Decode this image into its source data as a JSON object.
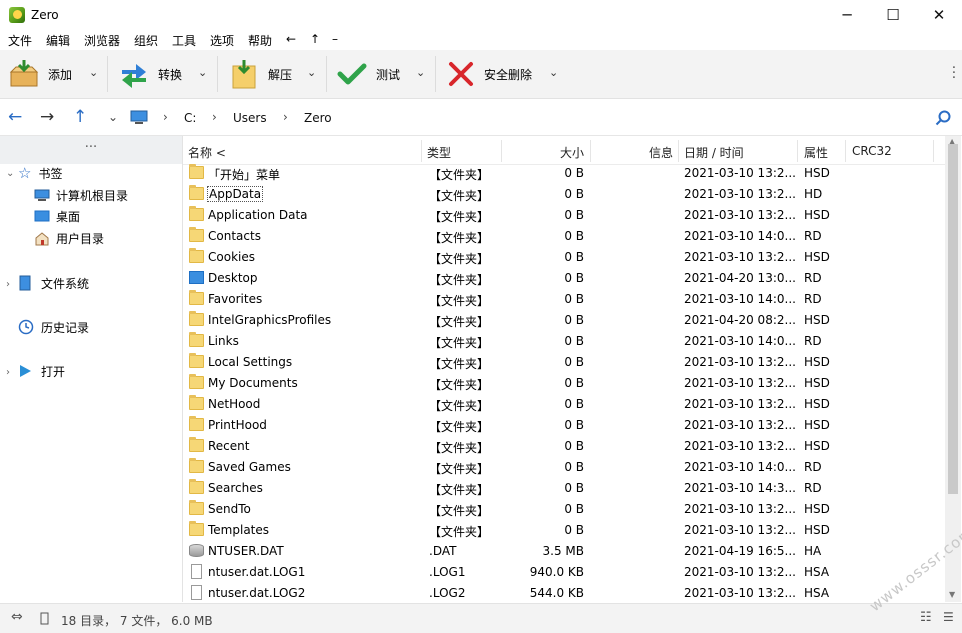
{
  "window": {
    "title": "Zero",
    "minimize": "─",
    "maximize": "☐",
    "close": "✕"
  },
  "menu": [
    "文件",
    "编辑",
    "浏览器",
    "组织",
    "工具",
    "选项",
    "帮助",
    "←",
    "↑",
    "–"
  ],
  "toolbar": {
    "add": "添加",
    "convert": "转换",
    "extract": "解压",
    "test": "测试",
    "secure_delete": "安全删除"
  },
  "address": {
    "path": [
      "C:",
      "Users",
      "Zero"
    ]
  },
  "sidebar": {
    "top": "···",
    "bookmarks": "书签",
    "computer_root": "计算机根目录",
    "desktop": "桌面",
    "user_dir": "用户目录",
    "filesystem": "文件系统",
    "history": "历史记录",
    "open": "打开"
  },
  "columns": {
    "name": "名称 <",
    "type": "类型",
    "size": "大小",
    "info": "信息",
    "date": "日期 / 时间",
    "attr": "属性",
    "crc": "CRC32"
  },
  "files": [
    {
      "name": "「开始」菜单",
      "type": "【文件夹】",
      "size": "0 B",
      "date": "2021-03-10 13:2...",
      "attr": "HSD",
      "icon": "folder"
    },
    {
      "name": "AppData",
      "type": "【文件夹】",
      "size": "0 B",
      "date": "2021-03-10 13:2...",
      "attr": "HD",
      "icon": "folder"
    },
    {
      "name": "Application Data",
      "type": "【文件夹】",
      "size": "0 B",
      "date": "2021-03-10 13:2...",
      "attr": "HSD",
      "icon": "folder"
    },
    {
      "name": "Contacts",
      "type": "【文件夹】",
      "size": "0 B",
      "date": "2021-03-10 14:0...",
      "attr": "RD",
      "icon": "folder"
    },
    {
      "name": "Cookies",
      "type": "【文件夹】",
      "size": "0 B",
      "date": "2021-03-10 13:2...",
      "attr": "HSD",
      "icon": "folder"
    },
    {
      "name": "Desktop",
      "type": "【文件夹】",
      "size": "0 B",
      "date": "2021-04-20 13:0...",
      "attr": "RD",
      "icon": "folder-blue"
    },
    {
      "name": "Favorites",
      "type": "【文件夹】",
      "size": "0 B",
      "date": "2021-03-10 14:0...",
      "attr": "RD",
      "icon": "folder"
    },
    {
      "name": "IntelGraphicsProfiles",
      "type": "【文件夹】",
      "size": "0 B",
      "date": "2021-04-20 08:2...",
      "attr": "HSD",
      "icon": "folder"
    },
    {
      "name": "Links",
      "type": "【文件夹】",
      "size": "0 B",
      "date": "2021-03-10 14:0...",
      "attr": "RD",
      "icon": "folder"
    },
    {
      "name": "Local Settings",
      "type": "【文件夹】",
      "size": "0 B",
      "date": "2021-03-10 13:2...",
      "attr": "HSD",
      "icon": "folder"
    },
    {
      "name": "My Documents",
      "type": "【文件夹】",
      "size": "0 B",
      "date": "2021-03-10 13:2...",
      "attr": "HSD",
      "icon": "folder"
    },
    {
      "name": "NetHood",
      "type": "【文件夹】",
      "size": "0 B",
      "date": "2021-03-10 13:2...",
      "attr": "HSD",
      "icon": "folder"
    },
    {
      "name": "PrintHood",
      "type": "【文件夹】",
      "size": "0 B",
      "date": "2021-03-10 13:2...",
      "attr": "HSD",
      "icon": "folder"
    },
    {
      "name": "Recent",
      "type": "【文件夹】",
      "size": "0 B",
      "date": "2021-03-10 13:2...",
      "attr": "HSD",
      "icon": "folder"
    },
    {
      "name": "Saved Games",
      "type": "【文件夹】",
      "size": "0 B",
      "date": "2021-03-10 14:0...",
      "attr": "RD",
      "icon": "folder"
    },
    {
      "name": "Searches",
      "type": "【文件夹】",
      "size": "0 B",
      "date": "2021-03-10 14:3...",
      "attr": "RD",
      "icon": "folder"
    },
    {
      "name": "SendTo",
      "type": "【文件夹】",
      "size": "0 B",
      "date": "2021-03-10 13:2...",
      "attr": "HSD",
      "icon": "folder"
    },
    {
      "name": "Templates",
      "type": "【文件夹】",
      "size": "0 B",
      "date": "2021-03-10 13:2...",
      "attr": "HSD",
      "icon": "folder"
    },
    {
      "name": "NTUSER.DAT",
      "type": ".DAT",
      "size": "3.5 MB",
      "date": "2021-04-19 16:5...",
      "attr": "HA",
      "icon": "dat"
    },
    {
      "name": "ntuser.dat.LOG1",
      "type": ".LOG1",
      "size": "940.0 KB",
      "date": "2021-03-10 13:2...",
      "attr": "HSA",
      "icon": "doc"
    },
    {
      "name": "ntuser.dat.LOG2",
      "type": ".LOG2",
      "size": "544.0 KB",
      "date": "2021-03-10 13:2...",
      "attr": "HSA",
      "icon": "doc"
    }
  ],
  "status": {
    "summary": "18 目录， 7 文件， 6.0 MB"
  },
  "watermark": "www.osssr.com"
}
